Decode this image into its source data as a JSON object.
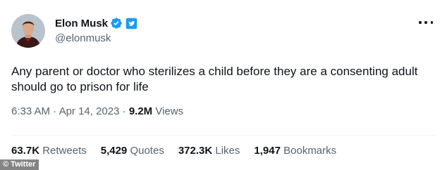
{
  "author": {
    "display_name": "Elon Musk",
    "handle": "@elonmusk",
    "verified_icon": "verified-check-icon",
    "brand_icon": "twitter-brand-badge-icon"
  },
  "tweet": {
    "text": "Any parent or doctor who sterilizes a child before they are a consenting adult should go to prison for life",
    "time": "6:33 AM",
    "separator": "·",
    "date": "Apr 14, 2023",
    "views_count": "9.2M",
    "views_label": "Views"
  },
  "stats": [
    {
      "count": "63.7K",
      "label": "Retweets"
    },
    {
      "count": "5,429",
      "label": "Quotes"
    },
    {
      "count": "372.3K",
      "label": "Likes"
    },
    {
      "count": "1,947",
      "label": "Bookmarks"
    }
  ],
  "watermark": "© Twitter",
  "colors": {
    "verified_blue": "#1d9bf0",
    "secondary_text": "#536471",
    "primary_text": "#0f1419"
  }
}
